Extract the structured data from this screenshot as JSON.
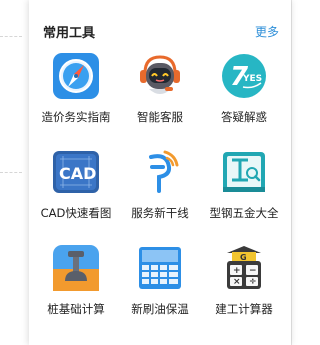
{
  "panel": {
    "title": "常用工具",
    "more": "更多"
  },
  "tools": [
    {
      "label": "造价务实指南",
      "icon": "compass-icon"
    },
    {
      "label": "智能客服",
      "icon": "robot-icon"
    },
    {
      "label": "答疑解惑",
      "icon": "qa-7yes-icon"
    },
    {
      "label": "CAD快速看图",
      "icon": "cad-icon"
    },
    {
      "label": "服务新干线",
      "icon": "service-line-icon"
    },
    {
      "label": "型钢五金大全",
      "icon": "steel-book-icon"
    },
    {
      "label": "桩基础计算",
      "icon": "pile-foundation-icon"
    },
    {
      "label": "新刷油保温",
      "icon": "paint-insulation-icon"
    },
    {
      "label": "建工计算器",
      "icon": "calculator-icon"
    }
  ],
  "colors": {
    "accent": "#2f8fd8",
    "title": "#222222",
    "icon_blue": "#2d8fe6",
    "icon_teal": "#27b6c4",
    "icon_orange": "#f29a2e"
  }
}
